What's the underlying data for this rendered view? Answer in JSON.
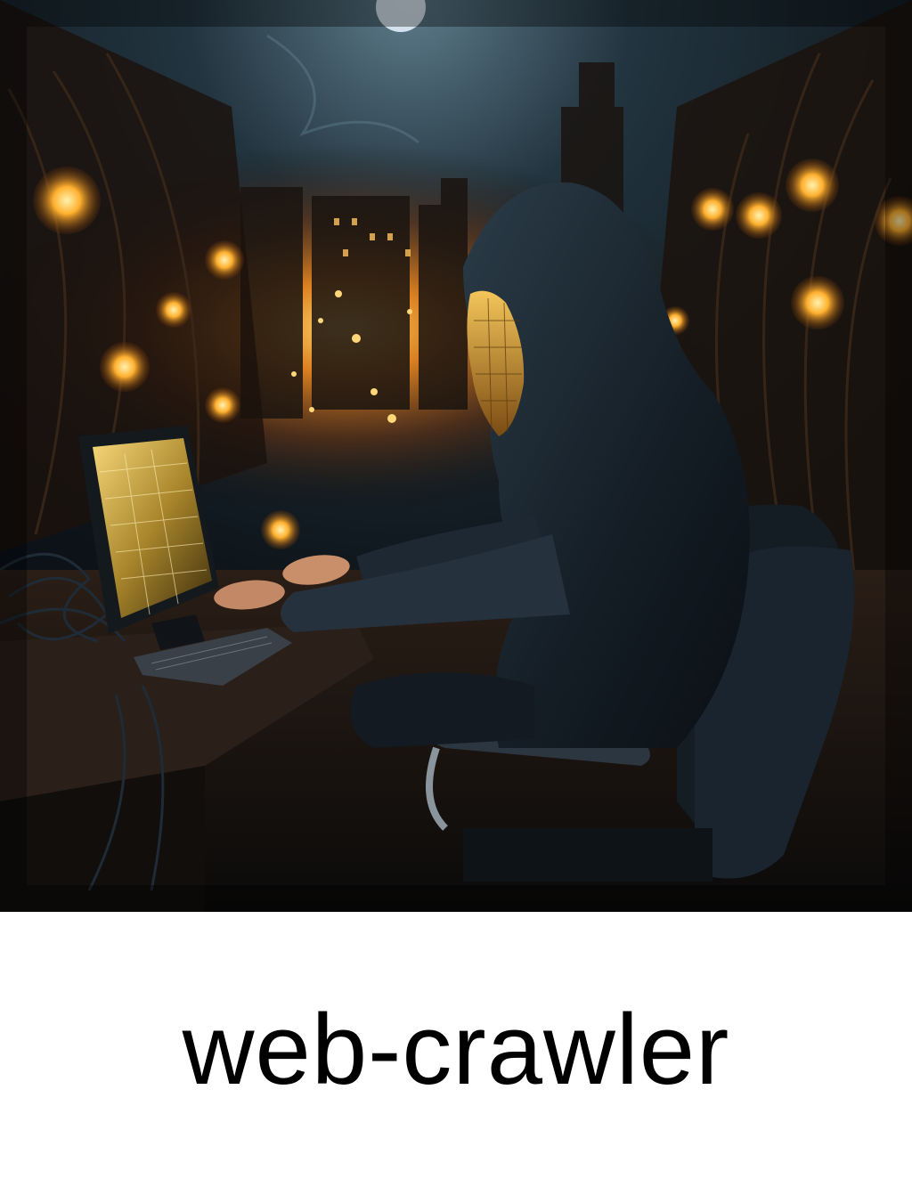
{
  "caption": {
    "text": "web-crawler"
  },
  "scene": {
    "subject": "hooded-figure-icon",
    "palette": {
      "sky": "#1b2a33",
      "glow": "#ffb13b",
      "hood": "#1a2530",
      "chair": "#141c24",
      "screen": "#d9b24a"
    }
  }
}
